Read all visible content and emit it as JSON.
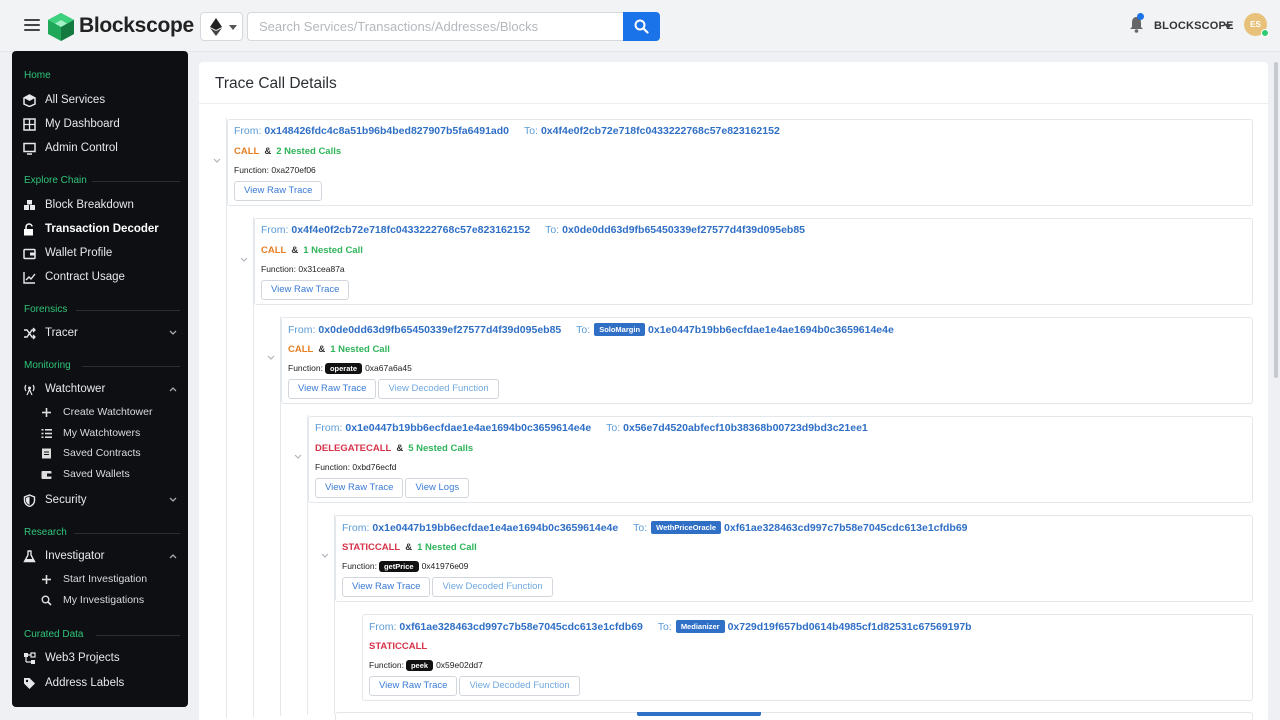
{
  "app": {
    "name": "Blockscope"
  },
  "search": {
    "placeholder": "Search Services/Transactions/Addresses/Blocks"
  },
  "user": {
    "name": "BLOCKSCOPE",
    "initials": "ES"
  },
  "colors": {
    "accent": "#1a73e8",
    "section": "#2fc47a",
    "sidebar_bg": "#0d0f12",
    "call": "#e67e22",
    "static": "#d6334a",
    "nested": "#2fb45a"
  },
  "sidebar": {
    "sections": [
      {
        "title": "Home",
        "items": [
          {
            "label": "All Services",
            "icon": "cube-icon"
          },
          {
            "label": "My Dashboard",
            "icon": "grid-icon"
          },
          {
            "label": "Admin Control",
            "icon": "monitor-icon"
          }
        ]
      },
      {
        "title": "Explore Chain",
        "items": [
          {
            "label": "Block Breakdown",
            "icon": "blocks-icon"
          },
          {
            "label": "Transaction Decoder",
            "icon": "unlock-icon",
            "active": true
          },
          {
            "label": "Wallet Profile",
            "icon": "wallet-icon"
          },
          {
            "label": "Contract Usage",
            "icon": "chart-icon"
          }
        ]
      },
      {
        "title": "Forensics",
        "items": [
          {
            "label": "Tracer",
            "icon": "shuffle-icon"
          }
        ]
      },
      {
        "title": "Monitoring",
        "items": [
          {
            "label": "Watchtower",
            "icon": "radio-icon",
            "sub": [
              {
                "label": "Create Watchtower",
                "icon": "plus-icon"
              },
              {
                "label": "My Watchtowers",
                "icon": "list-icon"
              },
              {
                "label": "Saved Contracts",
                "icon": "doc-icon"
              },
              {
                "label": "Saved Wallets",
                "icon": "wallet-icon"
              }
            ]
          },
          {
            "label": "Security",
            "icon": "shield-icon"
          }
        ]
      },
      {
        "title": "Research",
        "items": [
          {
            "label": "Investigator",
            "icon": "flask-icon",
            "sub": [
              {
                "label": "Start Investigation",
                "icon": "plus-icon"
              },
              {
                "label": "My Investigations",
                "icon": "magnifier-icon"
              }
            ]
          }
        ]
      },
      {
        "title": "Curated Data",
        "items": [
          {
            "label": "Web3 Projects",
            "icon": "nodes-icon"
          },
          {
            "label": "Address Labels",
            "icon": "tag-icon"
          }
        ]
      }
    ]
  },
  "page": {
    "title": "Trace Call Details"
  },
  "labels": {
    "from": "From:",
    "to": "To:",
    "function": "Function:",
    "amp": "&"
  },
  "traces": [
    {
      "from": "0x148426fdc4c8a51b96b4bed827907b5fa6491ad0",
      "to": "0x4f4e0f2cb72e718fc0433222768c57e823162152",
      "to_tag": "",
      "call_type": "CALL",
      "nested": "2 Nested Calls",
      "fn_name": "",
      "fn_sig": "0xa270ef06",
      "buttons": [
        "View Raw Trace"
      ]
    },
    {
      "from": "0x4f4e0f2cb72e718fc0433222768c57e823162152",
      "to": "0x0de0dd63d9fb65450339ef27577d4f39d095eb85",
      "to_tag": "",
      "call_type": "CALL",
      "nested": "1 Nested Call",
      "fn_name": "",
      "fn_sig": "0x31cea87a",
      "buttons": [
        "View Raw Trace"
      ]
    },
    {
      "from": "0x0de0dd63d9fb65450339ef27577d4f39d095eb85",
      "to": "0x1e0447b19bb6ecfdae1e4ae1694b0c3659614e4e",
      "to_tag": "SoloMargin",
      "call_type": "CALL",
      "nested": "1 Nested Call",
      "fn_name": "operate",
      "fn_sig": "0xa67a6a45",
      "buttons": [
        "View Raw Trace",
        "View Decoded Function"
      ]
    },
    {
      "from": "0x1e0447b19bb6ecfdae1e4ae1694b0c3659614e4e",
      "to": "0x56e7d4520abfecf10b38368b00723d9bd3c21ee1",
      "to_tag": "",
      "call_type": "DELEGATECALL",
      "nested": "5 Nested Calls",
      "fn_name": "",
      "fn_sig": "0xbd76ecfd",
      "buttons": [
        "View Raw Trace",
        "View Logs"
      ]
    },
    {
      "from": "0x1e0447b19bb6ecfdae1e4ae1694b0c3659614e4e",
      "to": "0xf61ae328463cd997c7b58e7045cdc613e1cfdb69",
      "to_tag": "WethPriceOracle",
      "call_type": "STATICCALL",
      "nested": "1 Nested Call",
      "fn_name": "getPrice",
      "fn_sig": "0x41976e09",
      "buttons": [
        "View Raw Trace",
        "View Decoded Function"
      ]
    },
    {
      "from": "0xf61ae328463cd997c7b58e7045cdc613e1cfdb69",
      "to": "0x729d19f657bd0614b4985cf1d82531c67569197b",
      "to_tag": "Medianizer",
      "call_type": "STATICCALL",
      "nested": "",
      "fn_name": "peek",
      "fn_sig": "0x59e02dd7",
      "buttons": [
        "View Raw Trace",
        "View Decoded Function"
      ]
    }
  ]
}
